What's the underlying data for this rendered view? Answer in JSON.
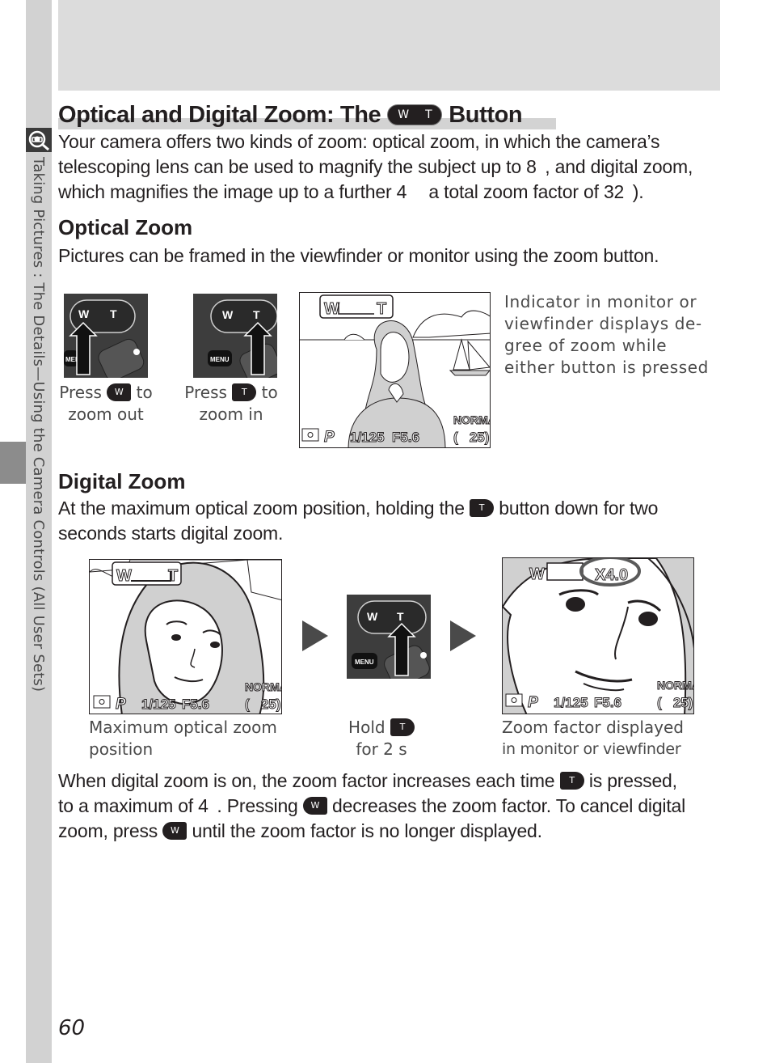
{
  "sidebar": {
    "section_text": "Taking Pictures : The Details—Using the Camera Controls (All User Sets)",
    "icon": "magnifier-camera-icon"
  },
  "title": {
    "before": "Optical and Digital Zoom: The",
    "button_w": "W",
    "button_t": "T",
    "after": "Button"
  },
  "intro": {
    "line1": "Your camera offers two kinds of zoom: optical zoom, in which the camera’s",
    "line2": "telescoping lens can be used to magnify the subject up to 8  , and digital zoom,",
    "line3": "which magnifies the image up to a further 4  a total zoom factor of 32  )."
  },
  "optical": {
    "heading": "Optical Zoom",
    "text": "Pictures can be framed in the viewfinder or monitor using the zoom button.",
    "figure_w": {
      "keys": {
        "w": "W",
        "t": "T",
        "menu": "MEN"
      },
      "caption_press": "Press",
      "caption_key": "W",
      "caption_to": "to",
      "caption_line2": "zoom out"
    },
    "figure_t": {
      "keys": {
        "w": "W",
        "t": "T",
        "menu": "MENU"
      },
      "caption_press": "Press",
      "caption_key": "T",
      "caption_to": "to",
      "caption_line2": "zoom in"
    },
    "monitor": {
      "zoom_w": "W",
      "zoom_t": "T",
      "mode": "P",
      "shutter": "1/125",
      "aperture": "F5.6",
      "quality": "NORMAL",
      "shots": "(   25)"
    },
    "note": "Indicator in monitor or viewfinder displays de-gree of zoom while either button is pressed"
  },
  "digital": {
    "heading": "Digital Zoom",
    "line1_before": "At the maximum optical zoom position, holding the",
    "line1_key": "T",
    "line1_after": "button down for two",
    "line2": "seconds starts digital zoom.",
    "fig1": {
      "zoom_w": "W",
      "zoom_t": "T",
      "mode": "P",
      "shutter": "1/125",
      "aperture": "F5.6",
      "quality": "NORMAL",
      "shots": "(   25)",
      "caption_line1": "Maximum optical zoom",
      "caption_line2": "position"
    },
    "fig2": {
      "keys": {
        "w": "W",
        "t": "T",
        "menu": "MENU"
      },
      "caption_hold": "Hold",
      "caption_key": "T",
      "caption_line2": "for 2 s"
    },
    "fig3": {
      "zoom_w": "W",
      "zoom_factor": "X4.0",
      "mode": "P",
      "shutter": "1/125",
      "aperture": "F5.6",
      "quality": "NORMAL",
      "shots": "(   25)",
      "caption_line1": "Zoom factor displayed",
      "caption_line2": "in monitor or viewfinder"
    },
    "para": {
      "l1_before": "When digital zoom is on, the zoom factor increases each time",
      "l1_key": "T",
      "l1_after": "is pressed,",
      "l2_before": "to a maximum of 4  . Pressing",
      "l2_key": "W",
      "l2_after": "decreases the zoom factor. To cancel digital",
      "l3_before": "zoom, press",
      "l3_key": "W",
      "l3_after": "until the zoom factor is no longer displayed."
    }
  },
  "page_number": "60"
}
